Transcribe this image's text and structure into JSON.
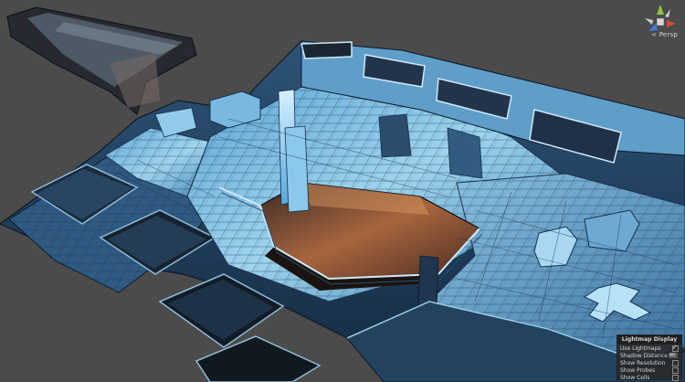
{
  "viewport": {
    "projection_label": "< Persp",
    "colors": {
      "background": "#4b4b4b",
      "floor_light": "#9fd4ee",
      "floor_mid": "#4f93c2",
      "wall_dark": "#1f3a55",
      "pit_warm": "#a7653e",
      "outline": "#0e1a26"
    }
  },
  "gizmo": {
    "icons": [
      "y-axis-icon",
      "x-axis-icon",
      "z-axis-icon",
      "center-cube-icon"
    ],
    "colors": {
      "x": "#d64a3a",
      "y": "#8ec63f",
      "z": "#3e7ad9"
    }
  },
  "lightmap_display": {
    "title": "Lightmap Display",
    "rows": [
      {
        "label": "Use Lightmaps",
        "type": "checkbox",
        "checked": true
      },
      {
        "label": "Shadow Distance",
        "type": "number",
        "value": "40"
      },
      {
        "label": "Show Resolution",
        "type": "checkbox",
        "checked": false
      },
      {
        "label": "Show Probes",
        "type": "checkbox",
        "checked": false
      },
      {
        "label": "Show Cells",
        "type": "checkbox",
        "checked": false
      }
    ]
  }
}
